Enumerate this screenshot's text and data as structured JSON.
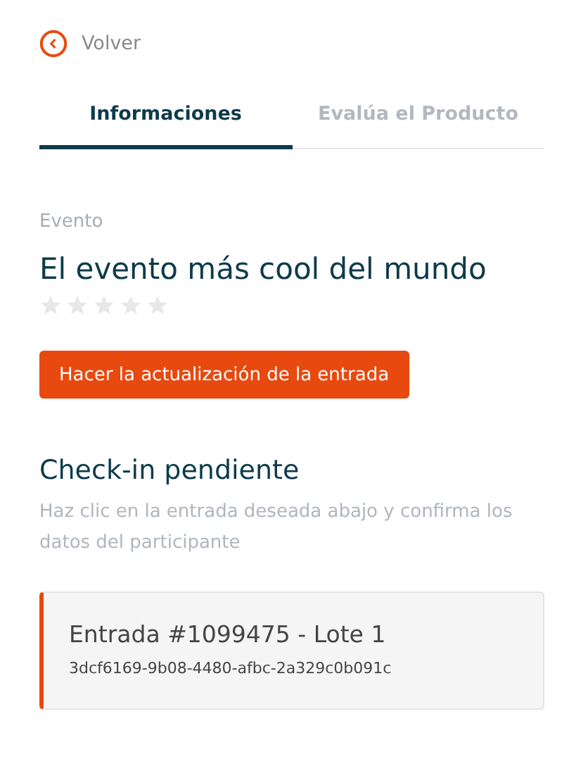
{
  "back_link": {
    "label": "Volver"
  },
  "tabs": [
    {
      "label": "Informaciones",
      "selected": true
    },
    {
      "label": "Evalúa el Producto",
      "selected": false
    }
  ],
  "event": {
    "label": "Evento",
    "title": "El evento más cool del mundo",
    "stars": 0
  },
  "update_button": {
    "label": "Hacer la actualización de la entrada"
  },
  "checkin": {
    "heading": "Check-in pendiente",
    "description": "Haz clic en la entrada deseada abajo y confirma los datos del participante",
    "tickets": [
      {
        "title": "Entrada #1099475 - Lote 1",
        "code": "3dcf6169-9b08-4480-afbc-2a329c0b091c"
      }
    ]
  }
}
